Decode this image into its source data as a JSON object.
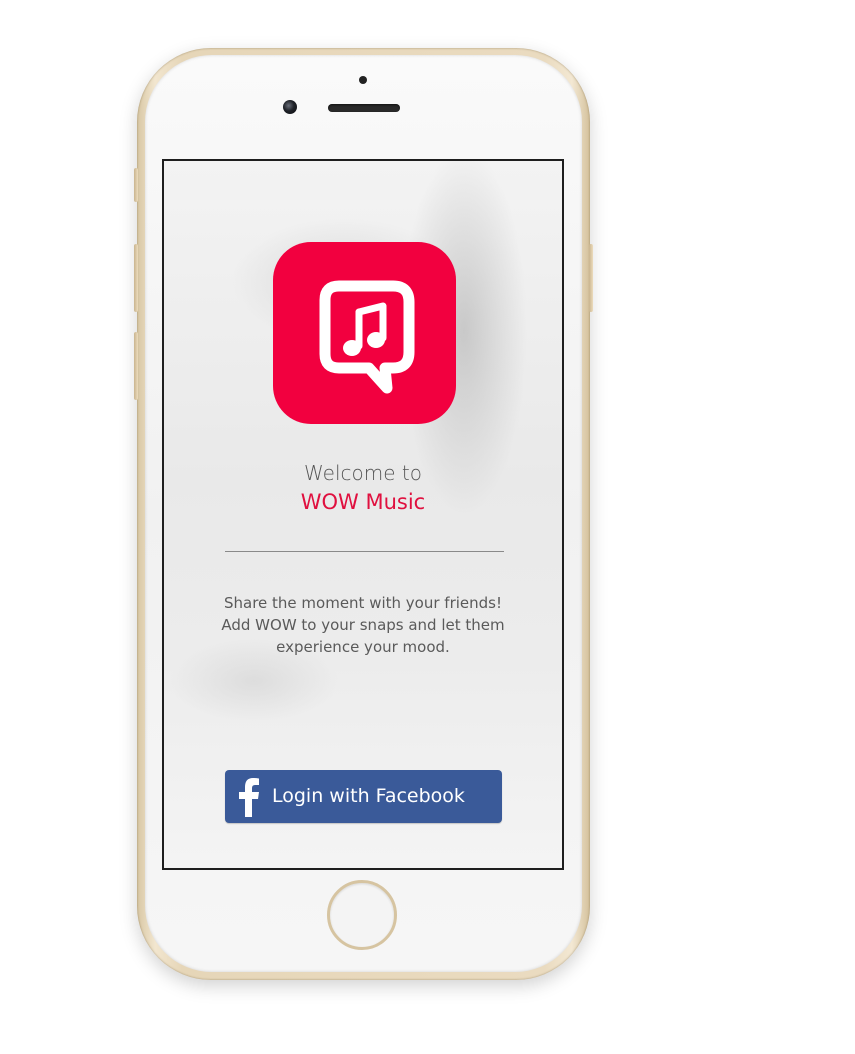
{
  "app": {
    "welcome_text": "Welcome to",
    "brand_name": "WOW Music",
    "description_lines": [
      "Share the moment with your friends!",
      "Add WOW to your snaps and let them",
      "experience your mood."
    ],
    "icon": "music-note-chat-bubble-icon"
  },
  "login": {
    "button_label": "Login with Facebook",
    "icon": "facebook-f-icon"
  },
  "colors": {
    "brand_red": "#f2003f",
    "brand_text": "#e0103f",
    "facebook_blue": "#3a5a99",
    "device_gold": "#e6d6b8"
  }
}
